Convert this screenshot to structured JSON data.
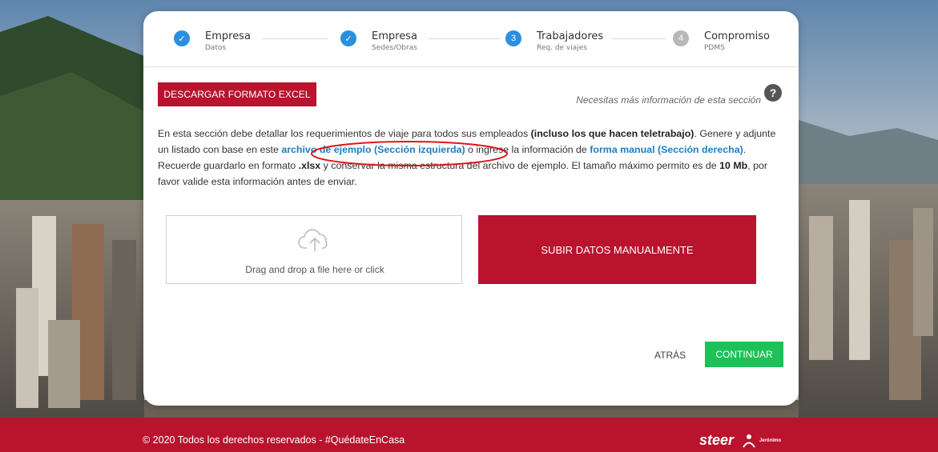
{
  "stepper": {
    "steps": [
      {
        "title": "Empresa",
        "subtitle": "Datos",
        "status": "done",
        "marker": "✓"
      },
      {
        "title": "Empresa",
        "subtitle": "Sedes/Obras",
        "status": "done",
        "marker": "✓"
      },
      {
        "title": "Trabajadores",
        "subtitle": "Req. de viajes",
        "status": "active",
        "marker": "3"
      },
      {
        "title": "Compromiso",
        "subtitle": "PDMS",
        "status": "pending",
        "marker": "4"
      }
    ]
  },
  "toolbar": {
    "download_label": "DESCARGAR FORMATO EXCEL",
    "help_text": "Necesitas más información de esta sección",
    "help_icon_glyph": "?"
  },
  "description": {
    "p1": "En esta sección debe detallar los requerimientos de viaje para todos sus empleados ",
    "p1_bold": "(incluso los que hacen teletrabajo)",
    "p2": ". Genere y adjunte un listado con base en este ",
    "link1": "archivo de ejemplo (Sección izquierda)",
    "p3": " o ingrese la información de ",
    "link2": "forma manual (Sección derecha)",
    "p4": ". Recuerde guardarlo en formato ",
    "format_bold": ".xlsx",
    "p5": " y conservar la misma estructura del archivo de ejemplo. El tamaño máximo permito es de ",
    "size_bold": "10 Mb",
    "p6": ", por favor valide esta información antes de enviar."
  },
  "upload": {
    "dropzone_text": "Drag and drop a file here or click",
    "icon": "cloud-upload-icon",
    "manual_label": "SUBIR DATOS MANUALMENTE"
  },
  "nav": {
    "back_label": "ATRÁS",
    "continue_label": "CONTINUAR"
  },
  "footer": {
    "copyright": "© 2020 Todos los derechos reservados - #QuédateEnCasa",
    "logo_text": "steer",
    "logo_sub": "Jerónimo"
  },
  "colors": {
    "brand_red": "#b9132e",
    "step_blue": "#2b8fe0",
    "link_blue": "#1a7fc4",
    "continue_green": "#1ec157"
  }
}
